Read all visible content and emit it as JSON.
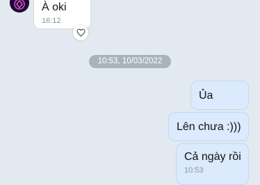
{
  "conversation": {
    "contact_avatar_icon": "contact-avatar",
    "date_separator": "10:53, 10/03/2022",
    "incoming": [
      {
        "text": "À oki",
        "time": "16:12",
        "reaction_icon": "heart-outline-icon"
      }
    ],
    "outgoing": [
      {
        "text": "Ủa"
      },
      {
        "text": "Lên chưa :)))"
      },
      {
        "text": "Cả ngày rồi",
        "time": "10:53"
      }
    ]
  },
  "colors": {
    "background": "#e2e9f0",
    "incoming_bubble": "#ffffff",
    "outgoing_bubble": "#dbeafc",
    "date_pill": "#a9b3bd",
    "timestamp": "#8a94a0"
  }
}
